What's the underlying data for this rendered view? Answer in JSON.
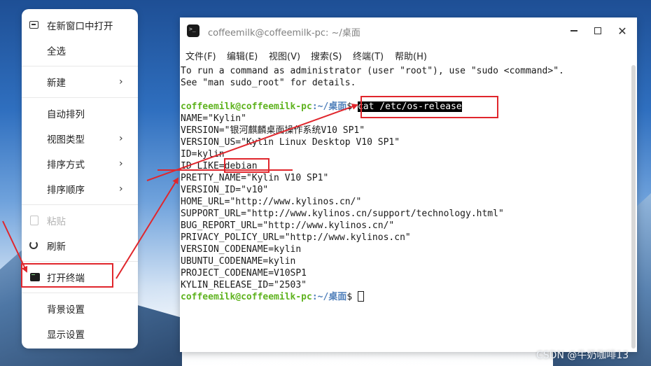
{
  "context_menu": {
    "items": [
      {
        "label": "在新窗口中打开",
        "chevron": "",
        "icon": "new-window-icon"
      },
      {
        "label": "全选",
        "chevron": ""
      },
      {
        "label": "新建",
        "chevron": "›"
      },
      {
        "label": "自动排列",
        "chevron": ""
      },
      {
        "label": "视图类型",
        "chevron": "›"
      },
      {
        "label": "排序方式",
        "chevron": "›"
      },
      {
        "label": "排序顺序",
        "chevron": "›"
      },
      {
        "label": "粘贴",
        "chevron": "",
        "icon": "paste-icon",
        "disabled": true
      },
      {
        "label": "刷新",
        "chevron": "",
        "icon": "refresh-icon"
      },
      {
        "label": "打开终端",
        "chevron": "",
        "icon": "terminal-icon"
      },
      {
        "label": "背景设置",
        "chevron": ""
      },
      {
        "label": "显示设置",
        "chevron": ""
      }
    ]
  },
  "terminal": {
    "title": "coffeemilk@coffeemilk-pc: ~/桌面",
    "menus": [
      "文件(F)",
      "编辑(E)",
      "视图(V)",
      "搜索(S)",
      "终端(T)",
      "帮助(H)"
    ],
    "intro": [
      "To run a command as administrator (user \"root\"), use \"sudo <command>\".",
      "See \"man sudo_root\" for details."
    ],
    "prompt_user": "coffeemilk@coffeemilk-pc",
    "prompt_path": ":~/桌面",
    "prompt_sign": "$ ",
    "command": "cat /etc/os-release",
    "output": [
      "NAME=\"Kylin\"",
      "VERSION=\"银河麒麟桌面操作系统V10 SP1\"",
      "VERSION_US=\"Kylin Linux Desktop V10 SP1\"",
      "ID=kylin",
      "ID_LIKE=debian",
      "PRETTY_NAME=\"Kylin V10 SP1\"",
      "VERSION_ID=\"v10\"",
      "HOME_URL=\"http://www.kylinos.cn/\"",
      "SUPPORT_URL=\"http://www.kylinos.cn/support/technology.html\"",
      "BUG_REPORT_URL=\"http://www.kylinos.cn/\"",
      "PRIVACY_POLICY_URL=\"http://www.kylinos.cn\"",
      "VERSION_CODENAME=kylin",
      "UBUNTU_CODENAME=kylin",
      "PROJECT_CODENAME=V10SP1",
      "KYLIN_RELEASE_ID=\"2503\""
    ]
  },
  "watermark": "CSDN @牛奶咖啡13",
  "colors": {
    "annotation": "#e0262c",
    "prompt_user": "#5fb31f",
    "prompt_path": "#4f7fba"
  }
}
